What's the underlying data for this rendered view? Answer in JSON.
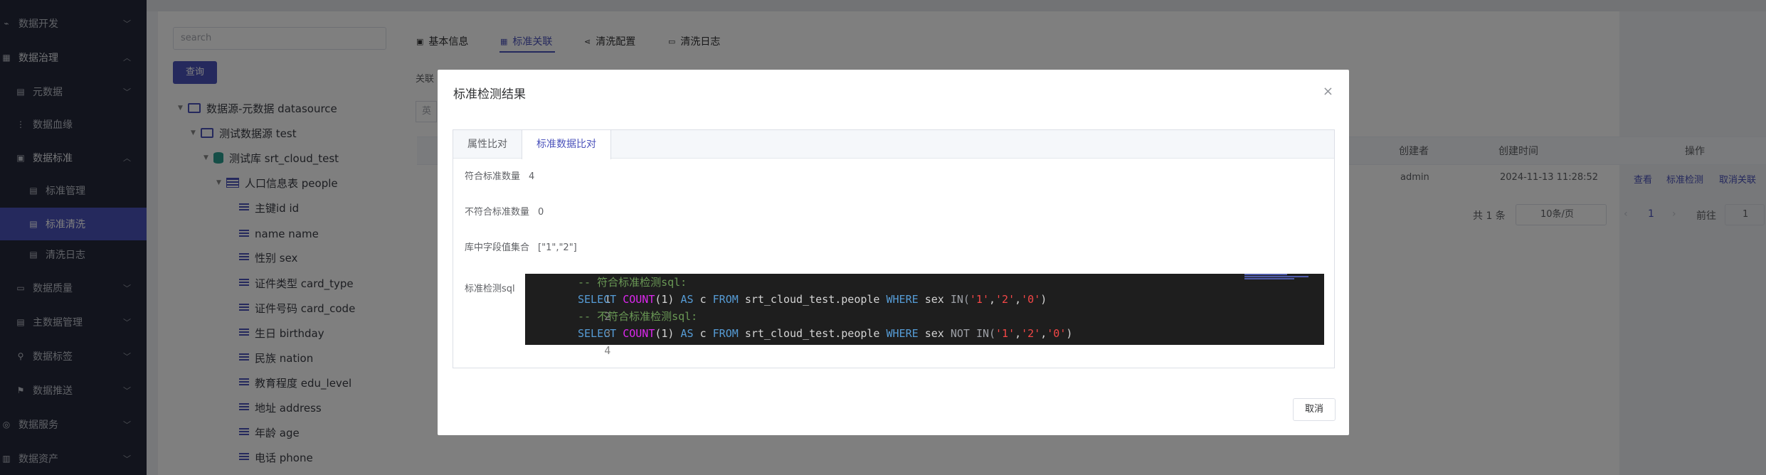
{
  "sidebar": {
    "items": [
      {
        "label": "数据开发",
        "icon": "code-icon",
        "chevron": "﹀"
      },
      {
        "label": "数据治理",
        "icon": "grid-icon",
        "chevron": "︿"
      },
      {
        "label": "元数据",
        "icon": "doc-icon",
        "chevron": "﹀"
      },
      {
        "label": "数据血缘",
        "icon": "lineage-icon",
        "chevron": ""
      },
      {
        "label": "数据标准",
        "icon": "standard-icon",
        "chevron": "︿"
      },
      {
        "label": "标准管理",
        "icon": "doc-icon",
        "chevron": ""
      },
      {
        "label": "标准清洗",
        "icon": "doc-icon",
        "chevron": ""
      },
      {
        "label": "清洗日志",
        "icon": "doc-icon",
        "chevron": ""
      },
      {
        "label": "数据质量",
        "icon": "quality-icon",
        "chevron": "﹀"
      },
      {
        "label": "主数据管理",
        "icon": "doc-icon",
        "chevron": "﹀"
      },
      {
        "label": "数据标签",
        "icon": "tag-icon",
        "chevron": "﹀"
      },
      {
        "label": "数据推送",
        "icon": "push-icon",
        "chevron": "﹀"
      },
      {
        "label": "数据服务",
        "icon": "service-icon",
        "chevron": "﹀"
      },
      {
        "label": "数据资产",
        "icon": "asset-icon",
        "chevron": "﹀"
      }
    ]
  },
  "tree": {
    "search_placeholder": "search",
    "query_label": "查询",
    "nodes": [
      {
        "label": "数据源-元数据   datasource",
        "kind": "folder"
      },
      {
        "label": "测试数据源   test",
        "kind": "folder"
      },
      {
        "label": "测试库   srt_cloud_test",
        "kind": "database"
      },
      {
        "label": "人口信息表   people",
        "kind": "table"
      },
      {
        "label": "主键id   id",
        "kind": "column"
      },
      {
        "label": "name   name",
        "kind": "column"
      },
      {
        "label": "性别   sex",
        "kind": "column"
      },
      {
        "label": "证件类型   card_type",
        "kind": "column"
      },
      {
        "label": "证件号码   card_code",
        "kind": "column"
      },
      {
        "label": "生日   birthday",
        "kind": "column"
      },
      {
        "label": "民族   nation",
        "kind": "column"
      },
      {
        "label": "教育程度   edu_level",
        "kind": "column"
      },
      {
        "label": "地址   address",
        "kind": "column"
      },
      {
        "label": "年龄   age",
        "kind": "column"
      },
      {
        "label": "电话   phone",
        "kind": "column"
      }
    ]
  },
  "detail": {
    "tabs": [
      {
        "label": "基本信息",
        "icon": "▣"
      },
      {
        "label": "标准关联",
        "icon": "▦"
      },
      {
        "label": "清洗配置",
        "icon": "⋖"
      },
      {
        "label": "清洗日志",
        "icon": "▭"
      }
    ],
    "filter_label": "关联",
    "filter_input_fragment": "英",
    "table": {
      "headers": {
        "creator": "创建者",
        "created_at": "创建时间",
        "actions": "操作"
      },
      "row": {
        "creator": "admin",
        "created_at": "2024-11-13 11:28:52",
        "view": "查看",
        "check": "标准检测",
        "unlink": "取消关联"
      }
    },
    "pager": {
      "total": "共 1 条",
      "page_size": "10条/页",
      "current": "1",
      "goto": "前往",
      "goto_value": "1",
      "prev": "‹",
      "next": "›"
    }
  },
  "modal": {
    "title": "标准检测结果",
    "close_icon": "×",
    "tabs": [
      "属性比对",
      "标准数据比对"
    ],
    "active_tab": 1,
    "fields": {
      "match_label": "符合标准数量",
      "match_value": "4",
      "mismatch_label": "不符合标准数量",
      "mismatch_value": "0",
      "value_set_label": "库中字段值集合",
      "value_set_value": "[\"1\",\"2\"]",
      "sql_label": "标准检测sql"
    },
    "code_lines": [
      "1",
      "2",
      "3",
      "4"
    ],
    "code": {
      "comment1": "-- 符合标准检测sql:",
      "comment2": "-- 不符合标准检测sql:",
      "kw_select": "SELECT",
      "fn_count": "COUNT",
      "count_arg": "(1)",
      "kw_as": "AS",
      "alias": "c",
      "kw_from": "FROM",
      "table": "srt_cloud_test.people",
      "kw_where": "WHERE",
      "column": "sex",
      "kw_in": "IN(",
      "kw_not": "NOT",
      "v1": "'1'",
      "v2": "'2'",
      "v3": "'0'",
      "comma": ",",
      "close": ")"
    },
    "cancel_label": "取消"
  },
  "colors": {
    "accent": "#4b52bb",
    "sidebar_bg": "#25293a",
    "code_bg": "#1e1e1e"
  }
}
